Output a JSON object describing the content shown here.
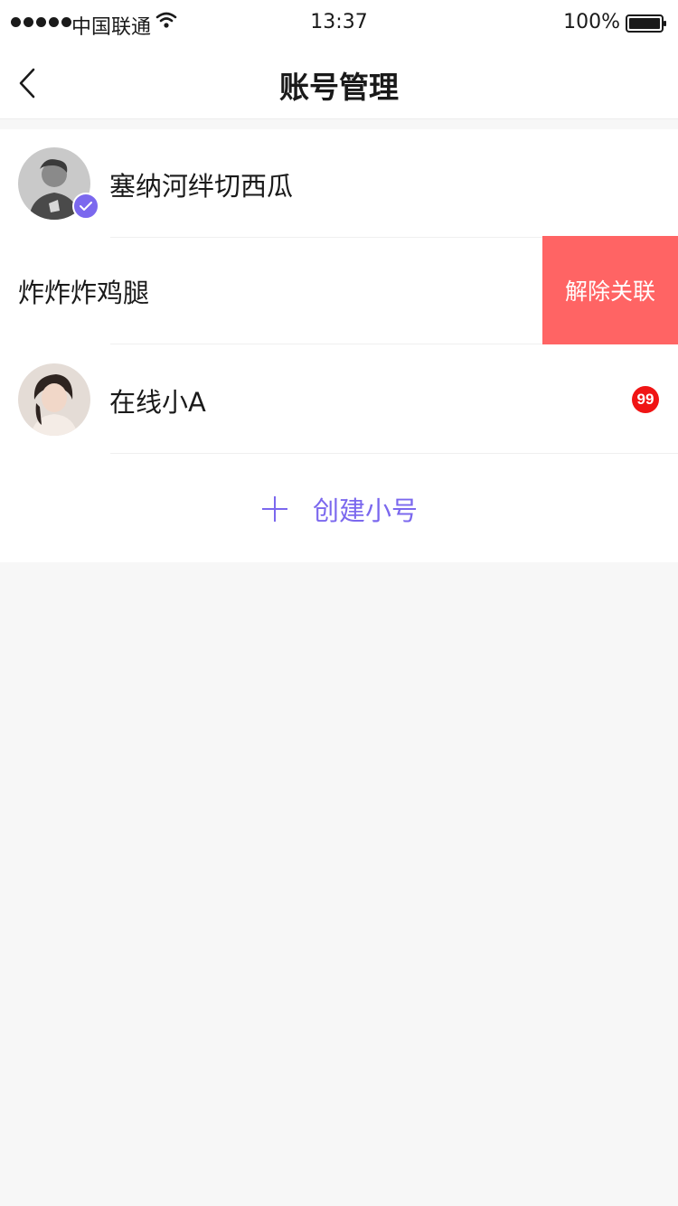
{
  "status_bar": {
    "carrier": "中国联通",
    "time": "13:37",
    "battery": "100%"
  },
  "nav": {
    "title": "账号管理",
    "back_icon": "chevron-left-icon"
  },
  "accounts": [
    {
      "name": "塞纳河绊切西瓜",
      "avatar": "avatar-man",
      "verified": true
    },
    {
      "name": "炸炸炸鸡腿",
      "swipe_action": "解除关联"
    },
    {
      "name": "在线小A",
      "avatar": "avatar-woman",
      "badge": "99"
    }
  ],
  "create": {
    "label": "创建小号",
    "icon": "plus-icon"
  },
  "colors": {
    "accent": "#7b68ee",
    "swipe_action_bg": "#ff6464",
    "badge_bg": "#f01414",
    "page_bg": "#f7f7f7"
  }
}
